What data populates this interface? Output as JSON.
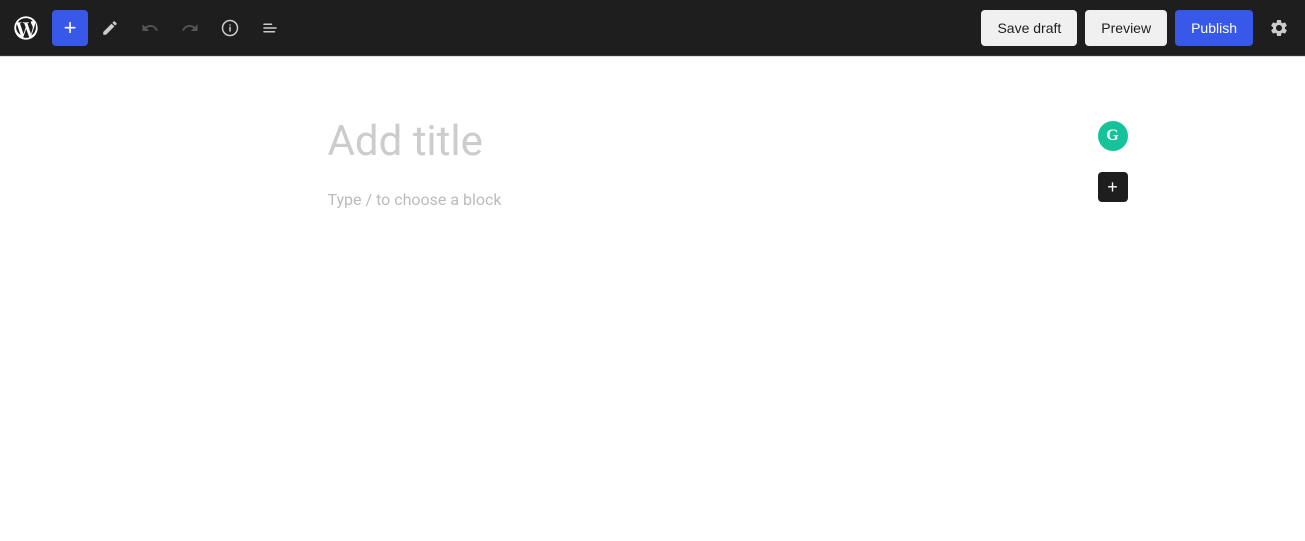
{
  "toolbar": {
    "add_label": "+",
    "save_draft_label": "Save draft",
    "preview_label": "Preview",
    "publish_label": "Publish",
    "colors": {
      "background": "#1e1e1e",
      "accent_blue": "#3858e9",
      "grammarly_green": "#15c39a",
      "btn_light_bg": "#f0f0f0"
    }
  },
  "editor": {
    "title_placeholder": "Add title",
    "block_placeholder": "Type / to choose a block"
  },
  "icons": {
    "add": "+",
    "pencil": "pencil-icon",
    "undo": "undo-icon",
    "redo": "redo-icon",
    "info": "info-icon",
    "list": "list-icon",
    "settings": "settings-icon",
    "grammarly": "G",
    "add_block": "+"
  }
}
